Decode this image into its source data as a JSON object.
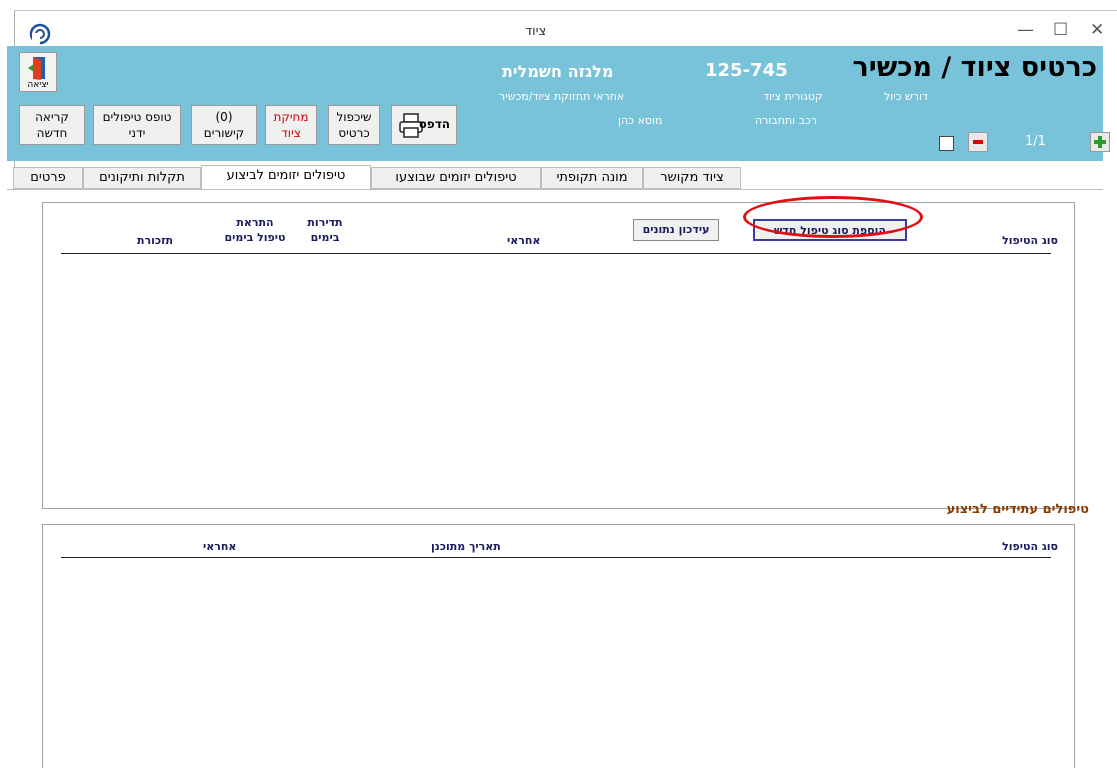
{
  "window": {
    "title": "ציוד"
  },
  "header": {
    "exit_label": "יציאה",
    "main_title": "כרטיס ציוד / מכשיר",
    "device_code": "125-745",
    "device_name": "מלגזה חשמלית",
    "responsible_label": "אחראי תחזוקת ציוד/מכשיר",
    "responsible_value": "מוסא כהן",
    "category_label": "קטגורית ציוד",
    "category_value": "רכב ותחבורה",
    "calibration_label": "דורש כיול",
    "counter": "1/1",
    "print_label": "הדפס",
    "buttons": {
      "refurbish_line1": "שיכפול",
      "refurbish_line2": "כרטיס",
      "delete_line1": "מחיקת",
      "delete_line2": "ציוד",
      "links_line1": "(0)",
      "links_line2": "קישורים",
      "manual_form_line1": "טופס טיפולים",
      "manual_form_line2": "ידני",
      "new_reading_line1": "קריאה",
      "new_reading_line2": "חדשה"
    }
  },
  "tabs": [
    {
      "label": "פרטים"
    },
    {
      "label": "תקלות ותיקונים"
    },
    {
      "label": "טיפולים יזומים לביצוע"
    },
    {
      "label": "טיפולים יזומים שבוצעו"
    },
    {
      "label": "מונה תקופתי"
    },
    {
      "label": "ציוד מקושר"
    }
  ],
  "panel1": {
    "col_type": "סוג הטיפול",
    "add_type_button": "הוספת סוג טיפול חדש",
    "update_button": "עידכון נתונים",
    "col_responsible": "אחראי",
    "col_freq_line1": "תדירות",
    "col_freq_line2": "בימים",
    "col_alert_line1": "התראת",
    "col_alert_line2": "טיפול בימים",
    "col_reminder": "תזכורת"
  },
  "panel2": {
    "section_title": "טיפולים עתידיים לביצוע",
    "col_type": "סוג הטיפול",
    "col_planned_date": "תאריך מתוכנן",
    "col_responsible": "אחראי"
  },
  "colors": {
    "header_bg": "#78c2da",
    "highlight": "#e01010",
    "section_title": "#8b3a00"
  }
}
